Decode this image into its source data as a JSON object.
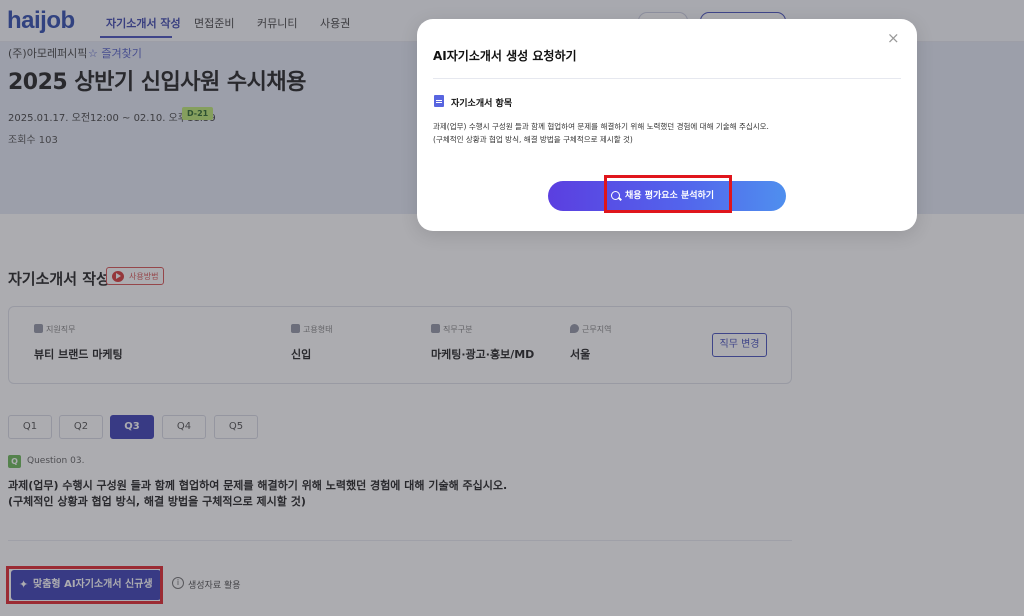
{
  "nav": {
    "logo": "haijob",
    "items": [
      "자기소개서 작성",
      "면접준비",
      "커뮤니티",
      "사용권"
    ]
  },
  "hero": {
    "company": "(주)아모레퍼시픽",
    "favorite": "즐겨찾기",
    "title": "2025 상반기 신입사원 수시채용",
    "period": "2025.01.17. 오전12:00 ~ 02.10. 오후11:59",
    "dday": "D-21",
    "views": "조회수 103"
  },
  "section": {
    "title": "자기소개서 작성",
    "howto": "사용방법"
  },
  "info": [
    {
      "label": "지원직무",
      "value": "뷰티 브랜드 마케팅",
      "icon": "briefcase-icon"
    },
    {
      "label": "고용형태",
      "value": "신입",
      "icon": "id-card-icon"
    },
    {
      "label": "직무구분",
      "value": "마케팅·광고·홍보/MD",
      "icon": "people-icon"
    },
    {
      "label": "근무지역",
      "value": "서울",
      "icon": "location-icon"
    }
  ],
  "change_button": "직무 변경",
  "tabs": [
    "Q1",
    "Q2",
    "Q3",
    "Q4",
    "Q5"
  ],
  "active_tab": "Q3",
  "question": {
    "badge": "Q",
    "number": "Question 03.",
    "line1": "과제(업무) 수행시 구성원 들과 함께 협업하여 문제를 해결하기 위해 노력했던 경험에 대해 기술해 주십시오.",
    "line2": "(구체적인 상황과 협업 방식, 해결 방법을 구체적으로 제시할 것)"
  },
  "actions": {
    "generate": "맞춤형 AI자기소개서 신규생성",
    "use_data": "생성자료 활용"
  },
  "modal": {
    "title": "AI자기소개서 생성 요청하기",
    "close": "×",
    "subtitle": "자기소개서 항목",
    "body_line1": "과제(업무) 수행시 구성원 들과 함께 협업하여 문제를 해결하기 위해 노력했던 경험에 대해 기술해 주십시오.",
    "body_line2": "(구체적인 상황과 협업 방식, 해결 방법을 구체적으로 제시할 것)",
    "analyze_button": "채용 평가요소 분석하기"
  },
  "colors": {
    "primary": "#2c30b0",
    "highlight": "#e0151c",
    "dday_badge": "#b9e86a",
    "question_badge": "#5fb34a"
  }
}
